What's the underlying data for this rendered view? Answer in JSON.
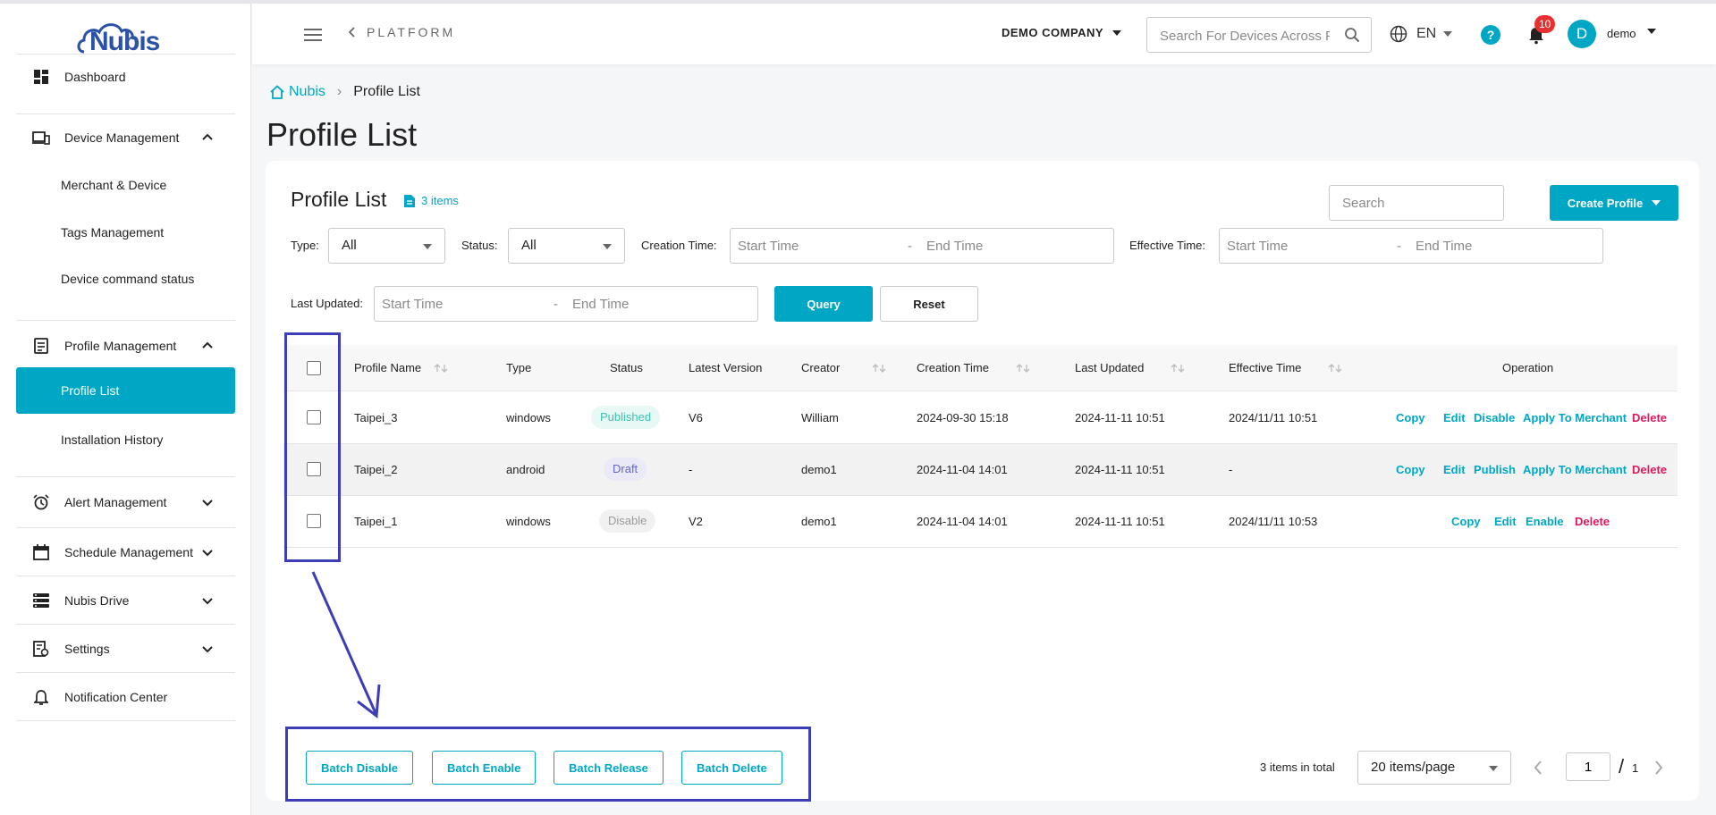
{
  "brand": {
    "logo_text": "Nubis"
  },
  "sidebar": {
    "items": [
      {
        "label": "Dashboard",
        "icon": "dashboard-icon"
      },
      {
        "label": "Device Management",
        "icon": "device-icon",
        "expanded": true,
        "children": [
          "Merchant & Device",
          "Tags Management",
          "Device command status"
        ]
      },
      {
        "label": "Profile Management",
        "icon": "profile-icon",
        "expanded": true,
        "children": [
          "Profile List",
          "Installation History"
        ]
      },
      {
        "label": "Alert Management",
        "icon": "alarm-icon",
        "expanded": false
      },
      {
        "label": "Schedule Management",
        "icon": "calendar-icon",
        "expanded": false
      },
      {
        "label": "Nubis Drive",
        "icon": "drive-icon",
        "expanded": false
      },
      {
        "label": "Settings",
        "icon": "settings-icon",
        "expanded": false
      },
      {
        "label": "Notification Center",
        "icon": "bell-icon"
      }
    ],
    "active": "Profile List"
  },
  "header": {
    "platform": "PLATFORM",
    "company": "DEMO COMPANY",
    "search_placeholder": "Search For Devices Across Platform",
    "language": "EN",
    "help": "?",
    "notifications": "10",
    "avatar_initial": "D",
    "username": "demo"
  },
  "breadcrumb": {
    "home": "Nubis",
    "current": "Profile List"
  },
  "page_title": "Profile List",
  "card": {
    "title": "Profile List",
    "count": "3 items",
    "search_placeholder": "Search",
    "create_label": "Create Profile"
  },
  "filters": {
    "type_label": "Type:",
    "type_value": "All",
    "status_label": "Status:",
    "status_value": "All",
    "creation_label": "Creation Time:",
    "effective_label": "Effective Time:",
    "updated_label": "Last Updated:",
    "start_placeholder": "Start Time",
    "end_placeholder": "End Time",
    "range_sep": "-",
    "query": "Query",
    "reset": "Reset"
  },
  "table": {
    "columns": [
      "Profile Name",
      "Type",
      "Status",
      "Latest Version",
      "Creator",
      "Creation Time",
      "Last Updated",
      "Effective Time",
      "Operation"
    ],
    "rows": [
      {
        "name": "Taipei_3",
        "type": "windows",
        "status": "Published",
        "version": "V6",
        "creator": "William",
        "created": "2024-09-30 15:18",
        "updated": "2024-11-11 10:51",
        "effective": "2024/11/11 10:51",
        "ops": [
          "Copy",
          "Edit",
          "Disable",
          "Apply To Merchant",
          "Delete"
        ]
      },
      {
        "name": "Taipei_2",
        "type": "android",
        "status": "Draft",
        "version": "-",
        "creator": "demo1",
        "created": "2024-11-04 14:01",
        "updated": "2024-11-11 10:51",
        "effective": "-",
        "ops": [
          "Copy",
          "Edit",
          "Publish",
          "Apply To Merchant",
          "Delete"
        ]
      },
      {
        "name": "Taipei_1",
        "type": "windows",
        "status": "Disable",
        "version": "V2",
        "creator": "demo1",
        "created": "2024-11-04 14:01",
        "updated": "2024-11-11 10:51",
        "effective": "2024/11/11 10:53",
        "ops": [
          "Copy",
          "Edit",
          "Enable",
          "Delete"
        ]
      }
    ]
  },
  "batch": {
    "disable": "Batch Disable",
    "enable": "Batch Enable",
    "release": "Batch Release",
    "delete": "Batch Delete"
  },
  "pagination": {
    "total": "3 items in total",
    "per_page": "20 items/page",
    "page": "1",
    "slash": "/",
    "pages": "1"
  },
  "colors": {
    "accent": "#00a7c4",
    "danger": "#d81b60",
    "annotation": "#3d3db8",
    "badge": "#e83030"
  }
}
